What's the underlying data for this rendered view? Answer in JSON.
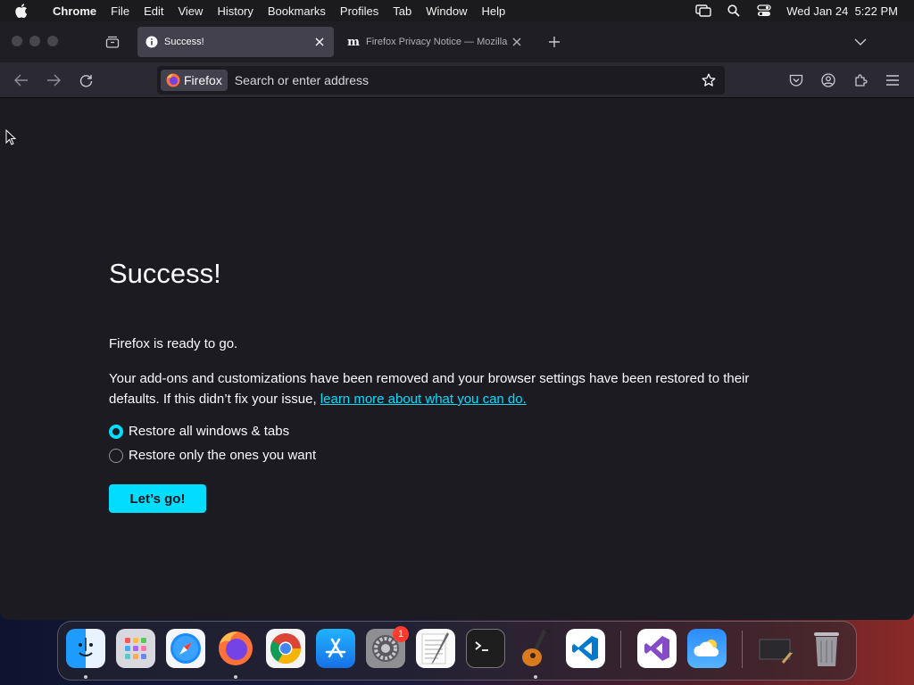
{
  "menubar": {
    "app_name": "Chrome",
    "items": [
      "File",
      "Edit",
      "View",
      "History",
      "Bookmarks",
      "Profiles",
      "Tab",
      "Window",
      "Help"
    ],
    "datetime": "Wed Jan 24  5:22 PM"
  },
  "tabs": [
    {
      "label": "Success!",
      "icon": "info-icon",
      "active": true
    },
    {
      "label": "Firefox Privacy Notice — Mozilla",
      "icon": "mozilla-m-icon",
      "active": false
    }
  ],
  "urlbar": {
    "identity_label": "Firefox",
    "placeholder": "Search or enter address",
    "value": ""
  },
  "page": {
    "title": "Success!",
    "ready_text": "Firefox is ready to go.",
    "description": "Your add-ons and customizations have been removed and your browser settings have been restored to their defaults. If this didn’t fix your issue,",
    "learn_more": "learn more about what you can do.",
    "options": [
      {
        "label": "Restore all windows & tabs",
        "checked": true
      },
      {
        "label": "Restore only the ones you want",
        "checked": false
      }
    ],
    "button_label": "Let’s go!"
  },
  "dock": {
    "apps": [
      "Finder",
      "Launchpad",
      "Safari",
      "Firefox",
      "Chrome",
      "App Store",
      "System Settings",
      "TextEdit",
      "Terminal",
      "GarageBand",
      "Visual Studio Code",
      "Visual Studio",
      "Weather",
      "Preview",
      "Trash"
    ],
    "system_settings_badge": "1"
  },
  "colors": {
    "accent": "#00ddff",
    "content_bg": "#1c1b22",
    "toolbar_bg": "#2b2a33"
  }
}
